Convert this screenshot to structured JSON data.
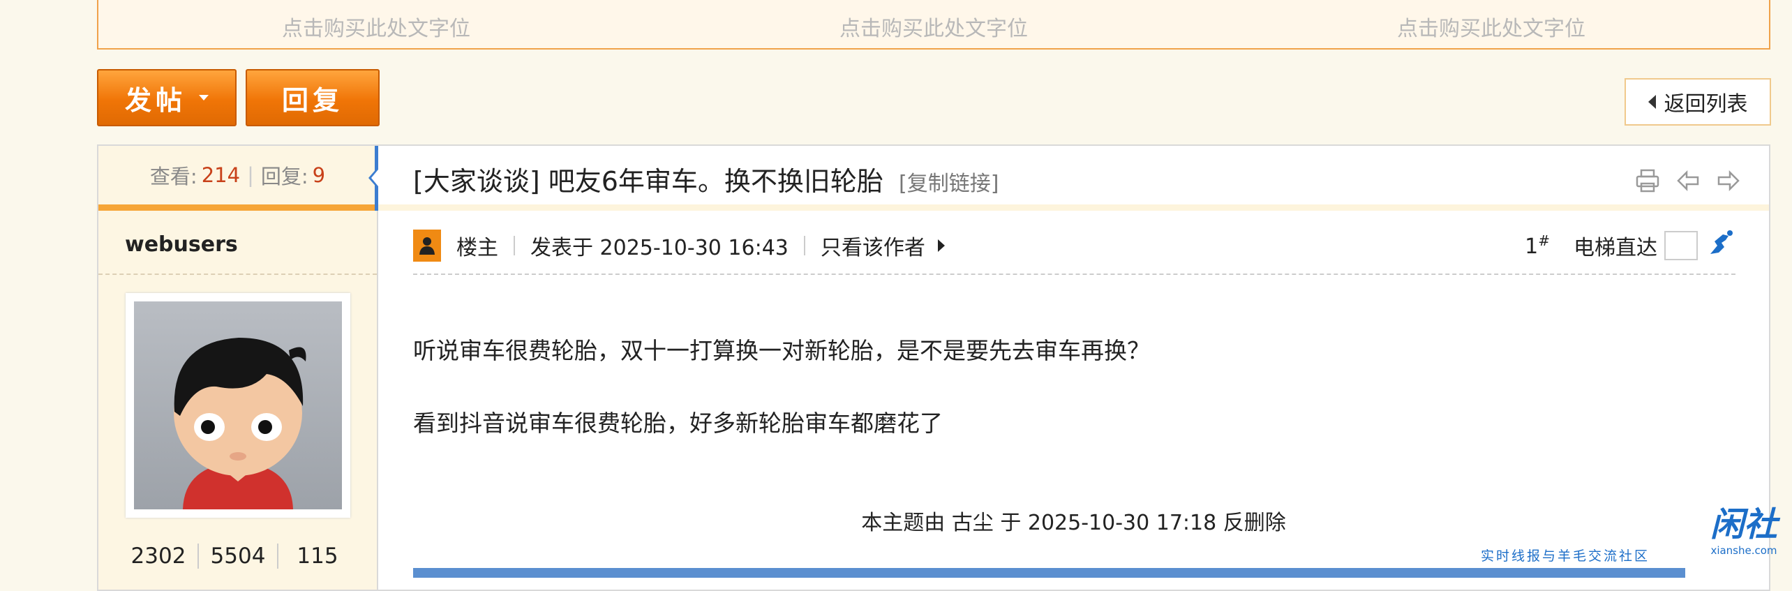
{
  "ad_slots": [
    "点击购买此处文字位",
    "点击购买此处文字位",
    "点击购买此处文字位"
  ],
  "toolbar": {
    "post_label": "发帖",
    "reply_label": "回复",
    "back_label": "返回列表"
  },
  "thread": {
    "stats": {
      "views_label": "查看:",
      "views": "214",
      "replies_label": "回复:",
      "replies": "9"
    },
    "category": "[大家谈谈]",
    "title": "吧友6年审车。换不换旧轮胎",
    "copy_link": "[复制链接]"
  },
  "post": {
    "author": "webusers",
    "author_stats": [
      "2302",
      "5504",
      "115"
    ],
    "role": "楼主",
    "posted_at": "发表于 2025-10-30 16:43",
    "only_author": "只看该作者",
    "floor": "1",
    "floor_sup": "#",
    "jump_label": "电梯直达",
    "body": [
      "听说审车很费轮胎，双十一打算换一对新轮胎，是不是要先去审车再换？",
      "看到抖音说审车很费轮胎，好多新轮胎审车都磨花了"
    ],
    "edit_note": "本主题由 古尘 于 2025-10-30 17:18 反删除"
  },
  "watermark": {
    "logo": "闲社",
    "domain": "xianshe.com",
    "slogan": "实时线报与羊毛交流社区"
  },
  "colors": {
    "accent_orange": "#f07507",
    "stat_number": "#c8411a",
    "link_blue": "#1c6ec8"
  }
}
